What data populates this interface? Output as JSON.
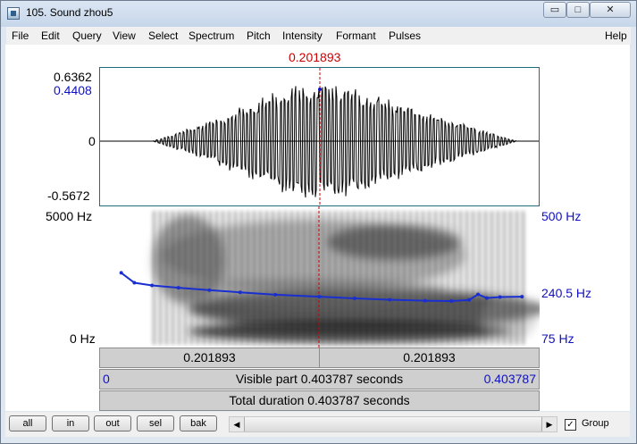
{
  "window": {
    "title": "105. Sound zhou5",
    "min_icon": "minimize-icon",
    "max_icon": "maximize-icon",
    "close_icon": "close-icon",
    "min_glyph": "▭",
    "max_glyph": "□",
    "close_glyph": "✕"
  },
  "menu": [
    "File",
    "Edit",
    "Query",
    "View",
    "Select",
    "Spectrum",
    "Pitch",
    "Intensity",
    "Formant",
    "Pulses",
    "Help"
  ],
  "cursor": {
    "time": "0.201893",
    "fraction": 0.5
  },
  "waveform": {
    "max": "0.6362",
    "cursor_value": "0.4408",
    "zero": "0",
    "min": "-0.5672"
  },
  "spectrogram": {
    "freq_max": "5000 Hz",
    "freq_min": "0 Hz",
    "pitch_max": "500 Hz",
    "pitch_mid": "240.5 Hz",
    "pitch_min": "75 Hz"
  },
  "pitch_track": {
    "t": [
      0.05,
      0.08,
      0.12,
      0.18,
      0.25,
      0.32,
      0.4,
      0.5,
      0.58,
      0.66,
      0.74,
      0.8,
      0.84,
      0.86,
      0.88,
      0.91,
      0.96
    ],
    "hz": [
      300,
      270,
      262,
      255,
      248,
      241,
      234,
      228,
      223,
      219,
      216,
      215,
      218,
      235,
      224,
      227,
      228
    ]
  },
  "selection": {
    "left_time": "0.201893",
    "right_time": "0.201893",
    "visible_start": "0",
    "visible_label": "Visible part 0.403787 seconds",
    "visible_end": "0.403787",
    "total_label": "Total duration 0.403787 seconds"
  },
  "buttons": {
    "all": "all",
    "in": "in",
    "out": "out",
    "sel": "sel",
    "bak": "bak"
  },
  "scroll": {
    "left_arrow": "◀",
    "right_arrow": "▶"
  },
  "group": {
    "label": "Group",
    "checked": true,
    "check_glyph": "✓"
  },
  "colors": {
    "cursor": "#cc0000",
    "pitch": "#1a2fd0",
    "axis_blue": "#1010c0"
  }
}
